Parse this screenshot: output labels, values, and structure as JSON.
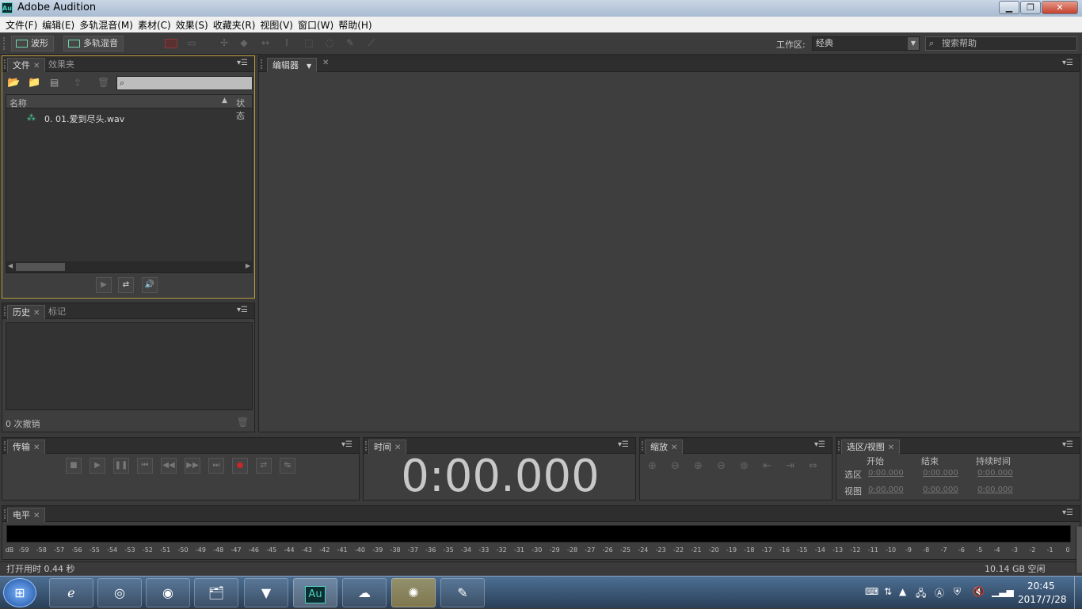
{
  "window": {
    "title": "Adobe Audition",
    "app_icon": "Au"
  },
  "menu": [
    "文件(F)",
    "编辑(E)",
    "多轨混音(M)",
    "素材(C)",
    "效果(S)",
    "收藏夹(R)",
    "视图(V)",
    "窗口(W)",
    "帮助(H)"
  ],
  "toolbar": {
    "waveform": "波形",
    "multitrack": "多轨混音",
    "workspace_label": "工作区:",
    "workspace_value": "经典",
    "help_search": "搜索帮助"
  },
  "files_panel": {
    "tabs": [
      "文件",
      "效果夹"
    ],
    "col_name": "名称",
    "col_status": "状态",
    "files": [
      "0. 01.爱到尽头.wav"
    ]
  },
  "history_panel": {
    "tabs": [
      "历史",
      "标记"
    ],
    "undo_count": "0 次撤销"
  },
  "editor": {
    "tab": "编辑器"
  },
  "transport": {
    "tab": "传输"
  },
  "time": {
    "tab": "时间",
    "value": "0:00.000"
  },
  "zoom": {
    "tab": "缩放"
  },
  "selection": {
    "tab": "选区/视图",
    "cols": [
      "开始",
      "结束",
      "持续时间"
    ],
    "rows": [
      {
        "label": "选区",
        "values": [
          "0:00.000",
          "0:00.000",
          "0:00.000"
        ]
      },
      {
        "label": "视图",
        "values": [
          "0:00.000",
          "0:00.000",
          "0:00.000"
        ]
      }
    ]
  },
  "levels": {
    "tab": "电平",
    "unit": "dB",
    "ticks": [
      "-59",
      "-58",
      "-57",
      "-56",
      "-55",
      "-54",
      "-53",
      "-52",
      "-51",
      "-50",
      "-49",
      "-48",
      "-47",
      "-46",
      "-45",
      "-44",
      "-43",
      "-42",
      "-41",
      "-40",
      "-39",
      "-38",
      "-37",
      "-36",
      "-35",
      "-34",
      "-33",
      "-32",
      "-31",
      "-30",
      "-29",
      "-28",
      "-27",
      "-26",
      "-25",
      "-24",
      "-23",
      "-22",
      "-21",
      "-20",
      "-19",
      "-18",
      "-17",
      "-16",
      "-15",
      "-14",
      "-13",
      "-12",
      "-11",
      "-10",
      "-9",
      "-8",
      "-7",
      "-6",
      "-5",
      "-4",
      "-3",
      "-2",
      "-1",
      "0"
    ]
  },
  "status": {
    "open_time": "打开用时 0.44 秒",
    "free_space": "10.14 GB 空闲"
  },
  "taskbar": {
    "time": "20:45",
    "date": "2017/7/28",
    "au_label": "Au"
  }
}
